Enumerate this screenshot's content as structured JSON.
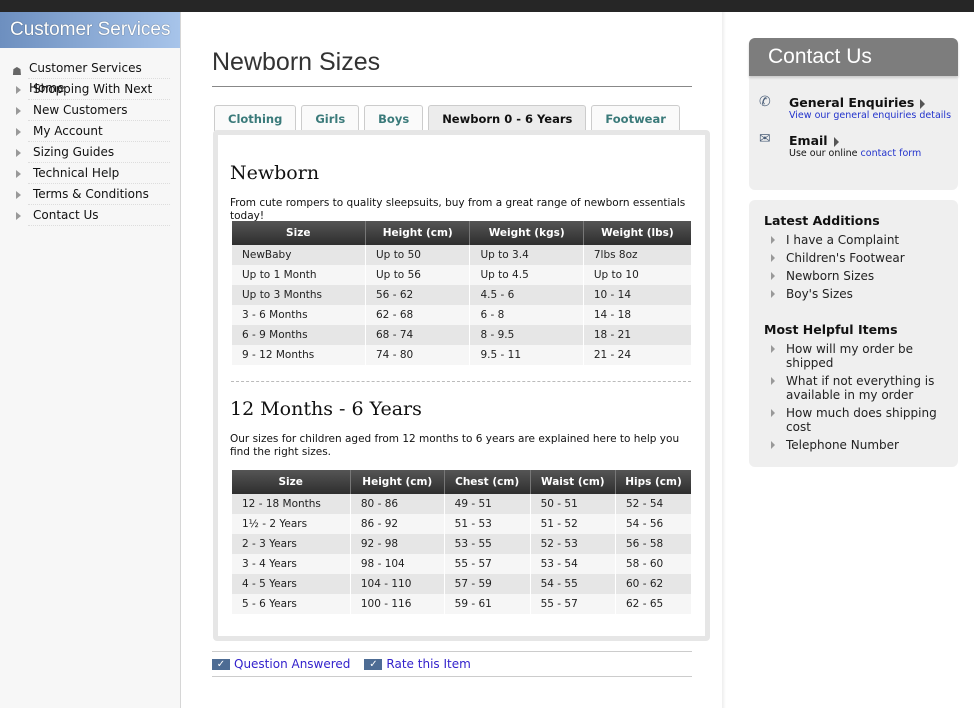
{
  "sidebar": {
    "title": "Customer Services",
    "home": "Customer Services Home",
    "items": [
      "Shopping With Next",
      "New Customers",
      "My Account",
      "Sizing Guides",
      "Technical Help",
      "Terms & Conditions",
      "Contact Us"
    ]
  },
  "main": {
    "title": "Newborn Sizes",
    "tabs": [
      "Clothing",
      "Girls",
      "Boys",
      "Newborn 0 - 6 Years",
      "Footwear"
    ],
    "active_tab": "Newborn 0 - 6 Years",
    "section1": {
      "heading": "Newborn",
      "description": "From cute rompers to quality sleepsuits, buy from a great range of newborn essentials today!",
      "columns": [
        "Size",
        "Height (cm)",
        "Weight (kgs)",
        "Weight (lbs)"
      ],
      "rows": [
        [
          "NewBaby",
          "Up to 50",
          "Up to 3.4",
          "7lbs 8oz"
        ],
        [
          "Up to 1 Month",
          "Up to 56",
          "Up to 4.5",
          "Up to 10"
        ],
        [
          "Up to 3 Months",
          "56 - 62",
          "4.5 - 6",
          "10 - 14"
        ],
        [
          "3 - 6 Months",
          "62 - 68",
          "6 - 8",
          "14 - 18"
        ],
        [
          "6 - 9 Months",
          "68 - 74",
          "8 - 9.5",
          "18 - 21"
        ],
        [
          "9 - 12 Months",
          "74 - 80",
          "9.5 - 11",
          "21 - 24"
        ]
      ]
    },
    "section2": {
      "heading": "12 Months - 6 Years",
      "description": "Our sizes for children aged from 12 months to 6 years are explained here to help you find the right sizes.",
      "columns": [
        "Size",
        "Height (cm)",
        "Chest (cm)",
        "Waist (cm)",
        "Hips (cm)"
      ],
      "rows": [
        [
          "12 - 18 Months",
          "80 - 86",
          "49 - 51",
          "50 - 51",
          "52 - 54"
        ],
        [
          "1½ - 2 Years",
          "86 - 92",
          "51 - 53",
          "51 - 52",
          "54 - 56"
        ],
        [
          "2 - 3 Years",
          "92 - 98",
          "53 - 55",
          "52 - 53",
          "56 - 58"
        ],
        [
          "3 - 4 Years",
          "98 - 104",
          "55 - 57",
          "53 - 54",
          "58 - 60"
        ],
        [
          "4 - 5 Years",
          "104 - 110",
          "57 - 59",
          "54 - 55",
          "60 - 62"
        ],
        [
          "5 - 6 Years",
          "100 - 116",
          "59 - 61",
          "55 - 57",
          "62 - 65"
        ]
      ]
    },
    "footer": {
      "question_answered": "Question Answered",
      "rate_item": "Rate this Item"
    }
  },
  "contact": {
    "title": "Contact Us",
    "general": "General Enquiries",
    "general_link": "View our general enquiries details",
    "email": "Email",
    "email_prefix": "Use our online",
    "email_link": "contact form"
  },
  "latest": {
    "heading": "Latest Additions",
    "items": [
      "I have a Complaint",
      "Children's Footwear",
      "Newborn Sizes",
      "Boy's Sizes"
    ]
  },
  "helpful": {
    "heading": "Most Helpful Items",
    "items": [
      "How will my order be shipped",
      "What if not everything is available in my order",
      "How much does shipping cost",
      "Telephone Number"
    ]
  }
}
